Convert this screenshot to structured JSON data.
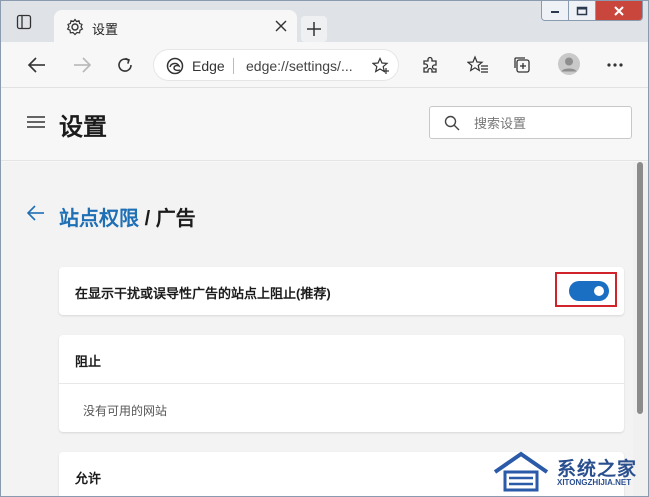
{
  "tab": {
    "title": "设置"
  },
  "address": {
    "site_label": "Edge",
    "url": "edge://settings/..."
  },
  "settings": {
    "title": "设置",
    "search_placeholder": "搜索设置"
  },
  "breadcrumb": {
    "parent": "站点权限",
    "separator": "/",
    "current": "广告"
  },
  "block_intrusive": {
    "label": "在显示干扰或误导性广告的站点上阻止(推荐)",
    "enabled": true
  },
  "block_section": {
    "header": "阻止",
    "empty_text": "没有可用的网站"
  },
  "allow_section": {
    "header": "允许"
  },
  "watermark": {
    "text": "系统之家",
    "sub": "XITONGZHIJIA.NET"
  },
  "colors": {
    "accent": "#1a6fc2",
    "highlight": "#d0242a",
    "link": "#1f6fb5"
  }
}
